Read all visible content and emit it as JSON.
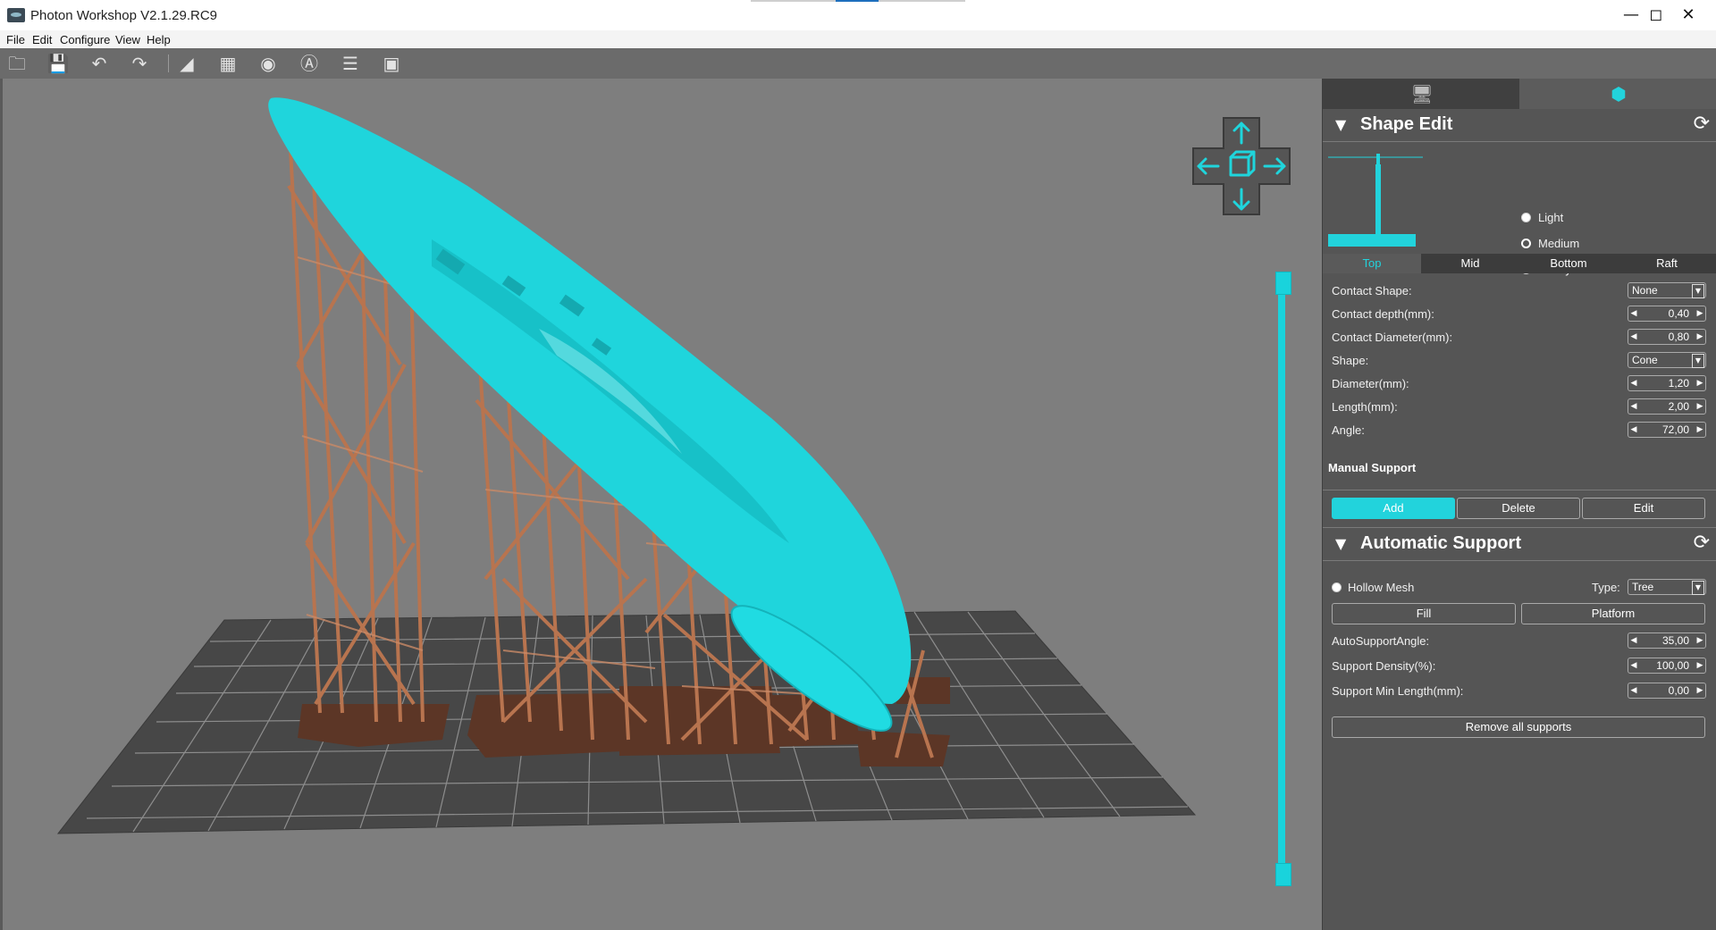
{
  "window": {
    "title": "Photon Workshop V2.1.29.RC9",
    "minimize_icon": "minimize-icon",
    "maximize_icon": "maximize-icon",
    "close_icon": "close-icon"
  },
  "menu": {
    "items": [
      "File",
      "Edit",
      "Configure",
      "View",
      "Help"
    ]
  },
  "toolbar": {
    "icons": [
      "open-folder-icon",
      "save-icon",
      "undo-icon",
      "redo-icon",
      "mirror-icon",
      "hollow-icon",
      "punch-hole-icon",
      "text-icon",
      "slice-icon",
      "fit-view-icon"
    ]
  },
  "viewport": {
    "model_color": "#1fd5dc",
    "support_color": "#b8744f",
    "raft_color": "#5c3626",
    "plate_color": "#444444",
    "z_slider": {
      "top_value": 1.0,
      "bottom_value": 0.0
    }
  },
  "panel": {
    "tabs": [
      {
        "icon": "printer-settings-icon",
        "active": false
      },
      {
        "icon": "support-model-icon",
        "active": true
      }
    ],
    "shape_edit": {
      "title": "Shape Edit",
      "presets": [
        "Light",
        "Medium",
        "Heavy"
      ],
      "selected_preset": "Medium",
      "subtabs": [
        "Top",
        "Mid",
        "Bottom",
        "Raft"
      ],
      "active_subtab": "Top",
      "props": [
        {
          "label": "Contact Shape:",
          "kind": "combo",
          "value": "None"
        },
        {
          "label": "Contact depth(mm):",
          "kind": "spin",
          "value": "0,40"
        },
        {
          "label": "Contact Diameter(mm):",
          "kind": "spin",
          "value": "0,80"
        },
        {
          "label": "Shape:",
          "kind": "combo",
          "value": "Cone"
        },
        {
          "label": "Diameter(mm):",
          "kind": "spin",
          "value": "1,20"
        },
        {
          "label": "Length(mm):",
          "kind": "spin",
          "value": "2,00"
        },
        {
          "label": "Angle:",
          "kind": "spin",
          "value": "72,00"
        }
      ]
    },
    "manual_support": {
      "title": "Manual Support",
      "buttons": [
        "Add",
        "Delete",
        "Edit"
      ],
      "active_button": "Add"
    },
    "auto_support": {
      "title": "Automatic Support",
      "hollow_mesh_label": "Hollow Mesh",
      "type_label": "Type:",
      "type_value": "Tree",
      "fill_label": "Fill",
      "platform_label": "Platform",
      "props": [
        {
          "label": "AutoSupportAngle:",
          "value": "35,00"
        },
        {
          "label": "Support Density(%):",
          "value": "100,00"
        },
        {
          "label": "Support Min Length(mm):",
          "value": "0,00"
        }
      ],
      "remove_label": "Remove all supports"
    }
  }
}
